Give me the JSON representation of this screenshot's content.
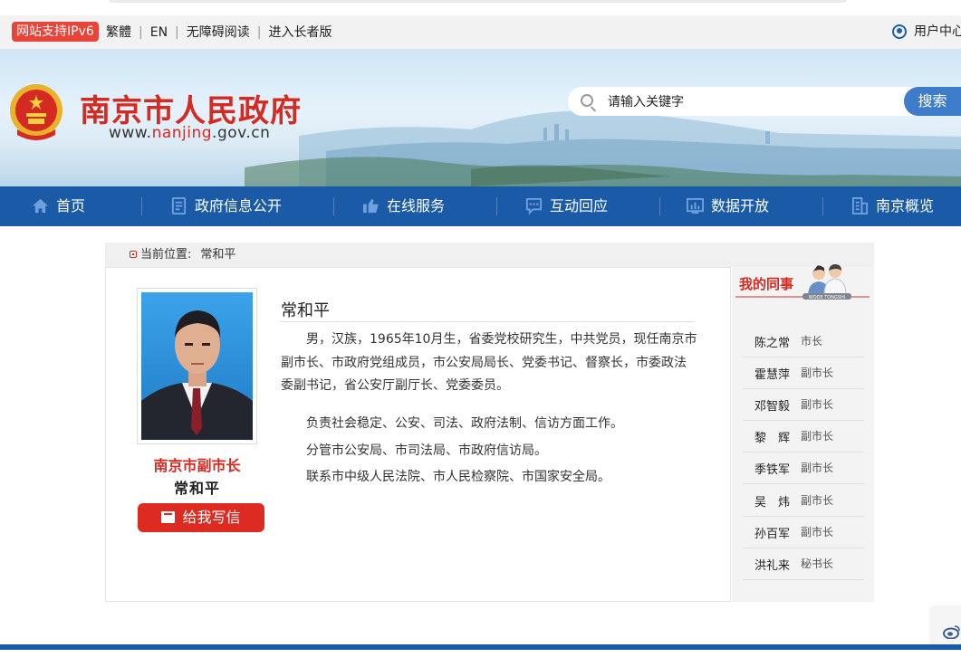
{
  "topbar": {
    "ipv6_badge": "网站支持IPv6",
    "links": [
      "繁體",
      "EN",
      "无障碍阅读",
      "进入长者版"
    ],
    "user_center": "用户中心"
  },
  "header": {
    "site_title": "南京市人民政府",
    "url_prefix": "www.",
    "url_domain": "nanjing",
    "url_suffix": ".gov.cn",
    "search_placeholder": "请输入关键字",
    "search_button": "搜索"
  },
  "nav": {
    "items": [
      {
        "label": "首页",
        "icon": "home-icon"
      },
      {
        "label": "政府信息公开",
        "icon": "document-icon"
      },
      {
        "label": "在线服务",
        "icon": "thumbs-up-icon"
      },
      {
        "label": "互动回应",
        "icon": "chat-icon"
      },
      {
        "label": "数据开放",
        "icon": "chart-icon"
      },
      {
        "label": "南京概览",
        "icon": "building-icon"
      }
    ]
  },
  "breadcrumb": {
    "prefix": "当前位置:",
    "current": "常和平"
  },
  "profile": {
    "name": "常和平",
    "photo_title": "南京市副市长",
    "photo_name": "常和平",
    "write_button": "给我写信",
    "bio": "男，汉族，1965年10月生，省委党校研究生，中共党员，现任南京市副市长、市政府党组成员，市公安局局长、党委书记、督察长，市委政法委副书记，省公安厅副厅长、党委委员。",
    "duties": [
      "负责社会稳定、公安、司法、政府法制、信访方面工作。",
      "分管市公安局、市司法局、市政府信访局。",
      "联系市中级人民法院、市人民检察院、市国家安全局。"
    ]
  },
  "colleagues": {
    "title": "我的同事",
    "art_text": "WODE TONGSHI",
    "list": [
      {
        "name": "陈之常",
        "title": "市长"
      },
      {
        "name": "霍慧萍",
        "title": "副市长"
      },
      {
        "name": "邓智毅",
        "title": "副市长"
      },
      {
        "name": "黎　辉",
        "title": "副市长"
      },
      {
        "name": "季铁军",
        "title": "副市长"
      },
      {
        "name": "吴　炜",
        "title": "副市长"
      },
      {
        "name": "孙百军",
        "title": "副市长"
      },
      {
        "name": "洪礼来",
        "title": "秘书长"
      }
    ]
  },
  "colors": {
    "brand_red": "#d42a22",
    "nav_blue": "#1b5aa6",
    "search_blue": "#3d7cc9"
  }
}
